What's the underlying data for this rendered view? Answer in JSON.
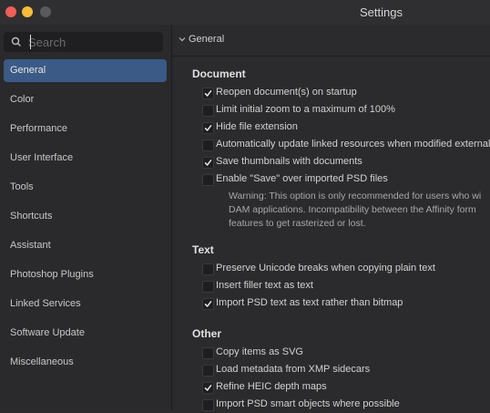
{
  "window": {
    "title": "Settings"
  },
  "search": {
    "placeholder": "Search"
  },
  "sidebar": {
    "items": [
      {
        "label": "General",
        "active": true
      },
      {
        "label": "Color"
      },
      {
        "label": "Performance"
      },
      {
        "label": "User Interface"
      },
      {
        "label": "Tools"
      },
      {
        "label": "Shortcuts"
      },
      {
        "label": "Assistant"
      },
      {
        "label": "Photoshop Plugins"
      },
      {
        "label": "Linked Services"
      },
      {
        "label": "Software Update"
      },
      {
        "label": "Miscellaneous"
      }
    ]
  },
  "content": {
    "section": "General",
    "groups": {
      "document": {
        "title": "Document",
        "options": [
          {
            "label": "Reopen document(s) on startup",
            "checked": true
          },
          {
            "label": "Limit initial zoom to a maximum of 100%",
            "checked": false
          },
          {
            "label": "Hide file extension",
            "checked": true
          },
          {
            "label": "Automatically update linked resources when modified externall",
            "checked": false
          },
          {
            "label": "Save thumbnails with documents",
            "checked": true
          },
          {
            "label": "Enable \"Save\" over imported PSD files",
            "checked": false
          }
        ],
        "warning": [
          "Warning: This option is only recommended for users who wi",
          "DAM applications. Incompatibility between the Affinity form",
          "features to get rasterized or lost."
        ]
      },
      "text": {
        "title": "Text",
        "options": [
          {
            "label": "Preserve Unicode breaks when copying plain text",
            "checked": false
          },
          {
            "label": "Insert filler text as text",
            "checked": false
          },
          {
            "label": "Import PSD text as text rather than bitmap",
            "checked": true
          }
        ]
      },
      "other": {
        "title": "Other",
        "options": [
          {
            "label": "Copy items as SVG",
            "checked": false
          },
          {
            "label": "Load metadata from XMP sidecars",
            "checked": false
          },
          {
            "label": "Refine HEIC depth maps",
            "checked": true
          },
          {
            "label": "Import PSD smart objects where possible",
            "checked": false
          }
        ]
      }
    }
  },
  "colors": {
    "accent": "#3b5a86",
    "close": "#ee5f58",
    "minimize": "#f6bd3b"
  }
}
